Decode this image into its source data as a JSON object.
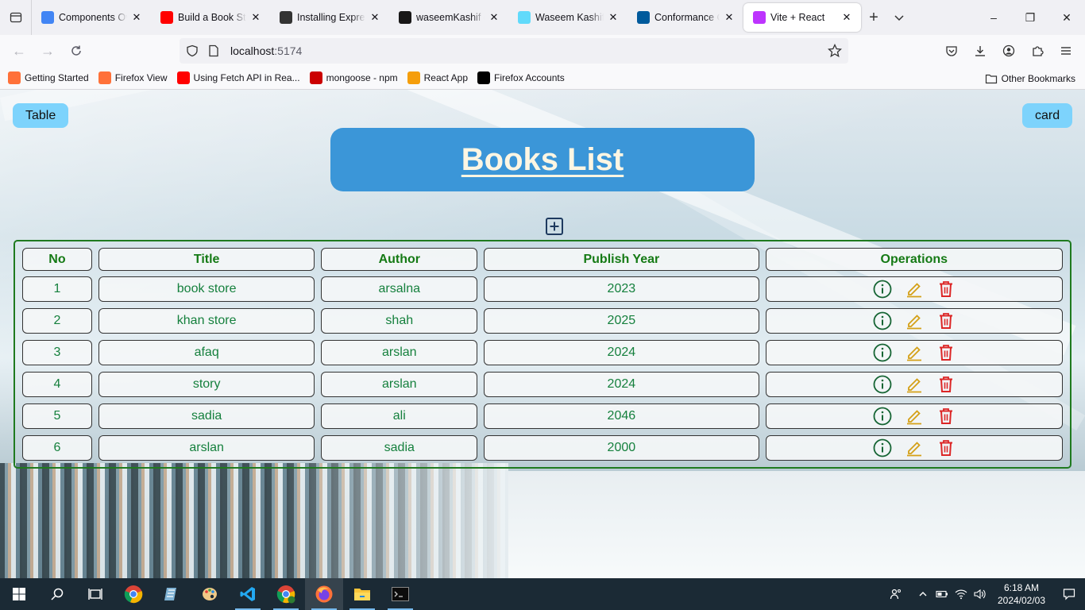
{
  "browser": {
    "tabs": [
      {
        "title": "Components Overview",
        "icon": "components-icon",
        "color": "#4285f4"
      },
      {
        "title": "Build a Book Store",
        "icon": "youtube-icon",
        "color": "#ff0000"
      },
      {
        "title": "Installing Express",
        "icon": "express-icon",
        "color": "#333333"
      },
      {
        "title": "waseemKashif (waseem)",
        "icon": "github-icon",
        "color": "#181717"
      },
      {
        "title": "Waseem Kashif",
        "icon": "react-icon",
        "color": "#61dafb"
      },
      {
        "title": "Conformance Criteria",
        "icon": "w3c-icon",
        "color": "#005a9c"
      },
      {
        "title": "Vite + React",
        "icon": "vite-icon",
        "color": "#bd34fe",
        "active": true
      }
    ],
    "url_host": "localhost",
    "url_port": ":5174",
    "bookmarks": [
      {
        "label": "Getting Started",
        "icon": "firefox-icon",
        "color": "#ff7139"
      },
      {
        "label": "Firefox View",
        "icon": "firefox-view-icon",
        "color": "#ff7139"
      },
      {
        "label": "Using Fetch API in Rea...",
        "icon": "youtube-icon",
        "color": "#ff0000"
      },
      {
        "label": "mongoose - npm",
        "icon": "npm-icon",
        "color": "#cb0000"
      },
      {
        "label": "React App",
        "icon": "react-app-icon",
        "color": "#f59e0b"
      },
      {
        "label": "Firefox Accounts",
        "icon": "mozilla-icon",
        "color": "#000000"
      }
    ],
    "other_bookmarks": "Other Bookmarks"
  },
  "page": {
    "table_toggle": "Table",
    "card_toggle": "card",
    "title": "Books List",
    "headers": {
      "no": "No",
      "title": "Title",
      "author": "Author",
      "year": "Publish Year",
      "ops": "Operations"
    },
    "books": [
      {
        "no": "1",
        "title": "book store",
        "author": "arsalna",
        "year": "2023"
      },
      {
        "no": "2",
        "title": "khan store",
        "author": "shah",
        "year": "2025"
      },
      {
        "no": "3",
        "title": "afaq",
        "author": "arslan",
        "year": "2024"
      },
      {
        "no": "4",
        "title": "story",
        "author": "arslan",
        "year": "2024"
      },
      {
        "no": "5",
        "title": "sadia",
        "author": "ali",
        "year": "2046"
      },
      {
        "no": "6",
        "title": "arslan",
        "author": "sadia",
        "year": "2000"
      }
    ],
    "colors": {
      "accent": "#3b96d8",
      "toggle": "#7dd3fc",
      "text_green": "#15803d",
      "info": "#166534",
      "edit": "#d4a017",
      "delete": "#dc2626"
    }
  },
  "taskbar": {
    "time": "6:18 AM",
    "date": "2024/02/03"
  }
}
